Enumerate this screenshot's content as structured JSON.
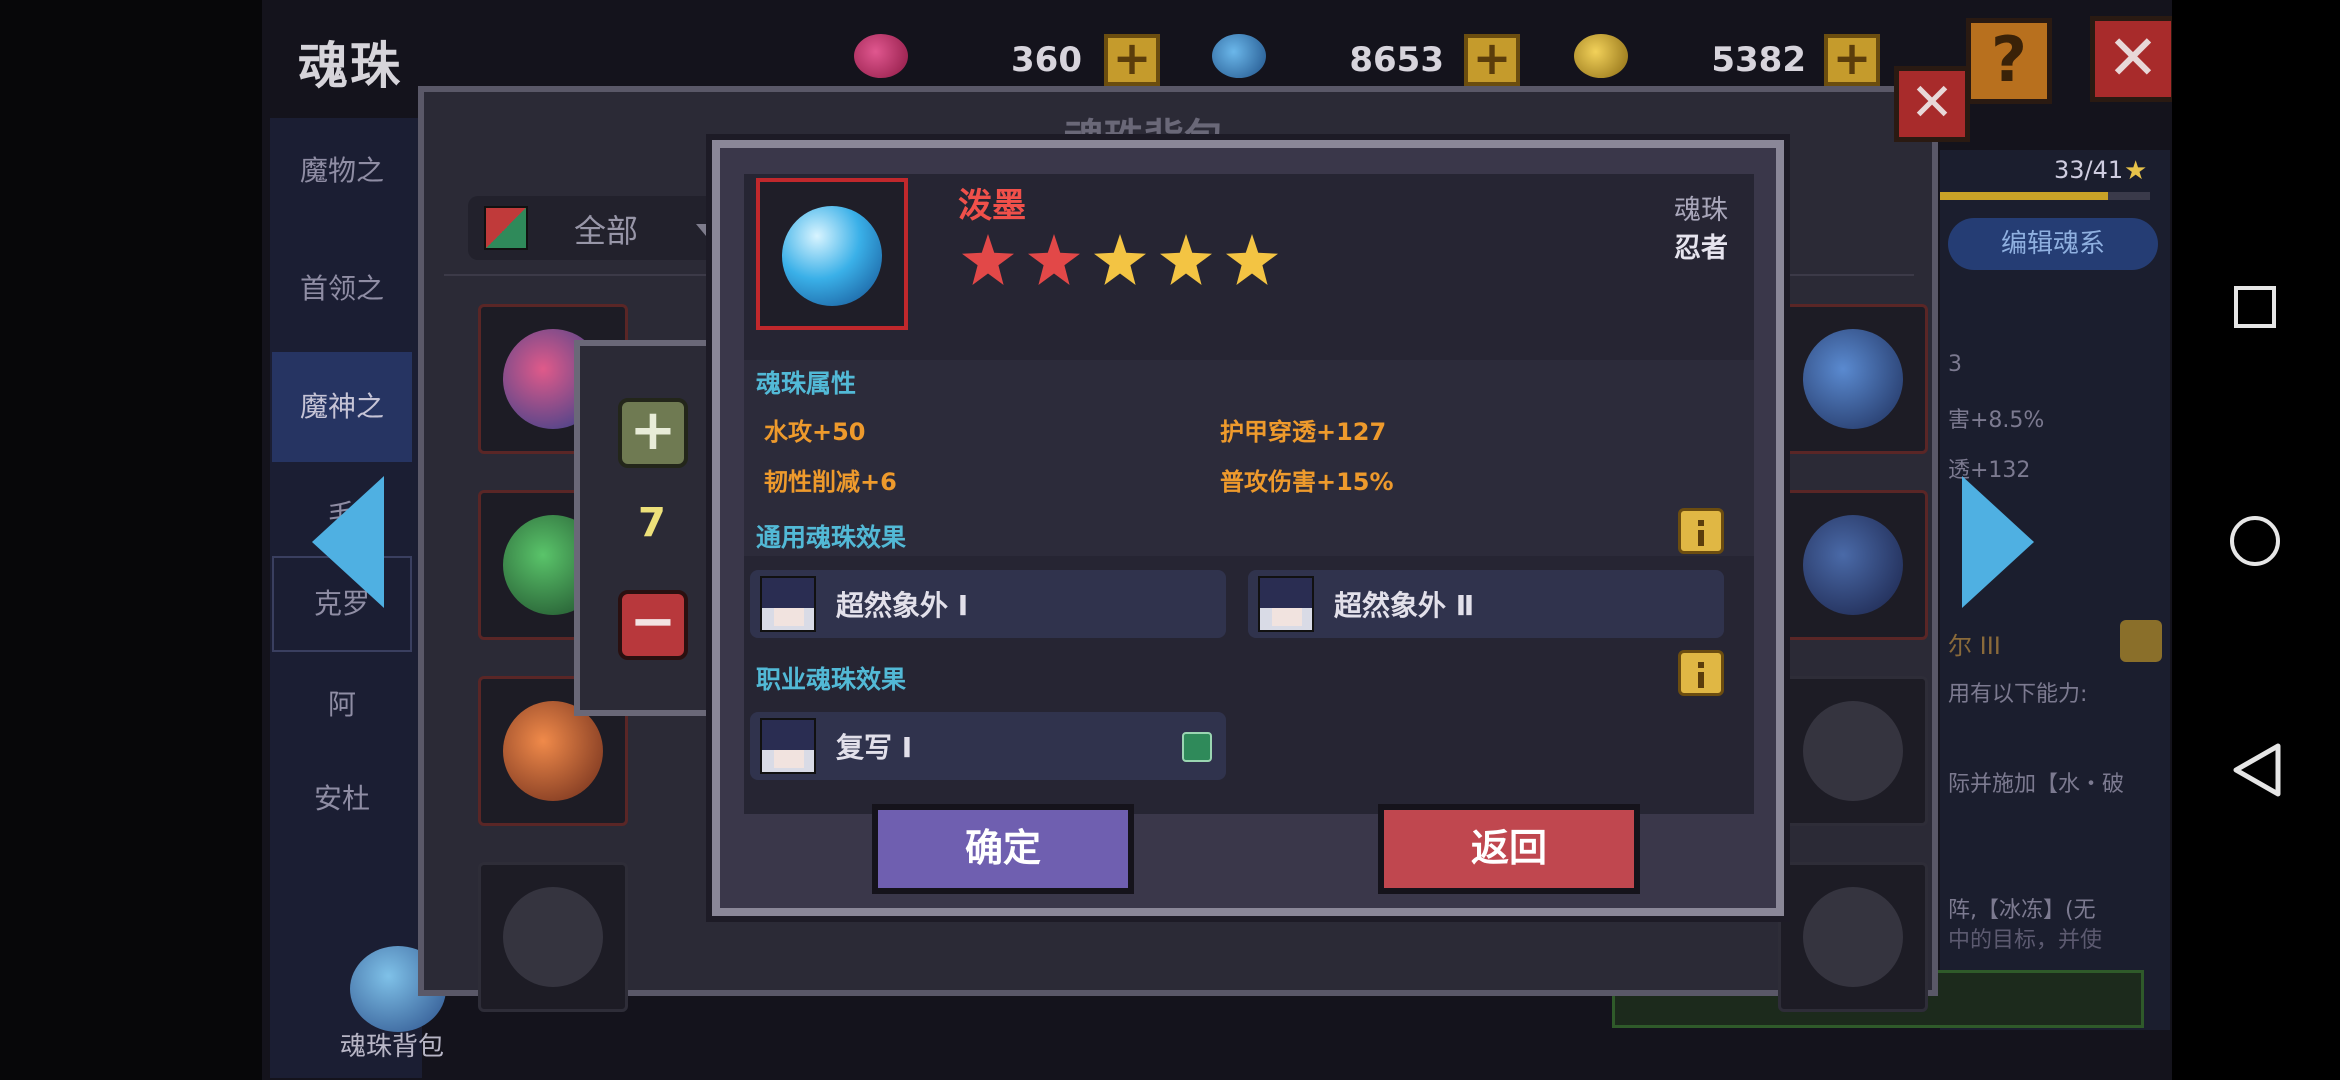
{
  "screen_title": "魂珠",
  "currencies": [
    {
      "icon": "purple-gem-icon",
      "value": "360",
      "color": "#b0245e"
    },
    {
      "icon": "blue-gem-icon",
      "value": "8653",
      "color": "#2f78b8"
    },
    {
      "icon": "gold-coin-icon",
      "value": "5382",
      "color": "#c9a227"
    }
  ],
  "side_tabs": [
    {
      "label": "魔物之"
    },
    {
      "label": "首领之"
    },
    {
      "label": "魔神之"
    },
    {
      "label": "毛"
    },
    {
      "label": "克罗"
    },
    {
      "label": "阿"
    },
    {
      "label": "安杜"
    }
  ],
  "bag": {
    "title": "魂珠背包",
    "filter_label": "全部",
    "bottom_label": "魂珠背包"
  },
  "quantity": {
    "value": "7"
  },
  "right_panel": {
    "count": "33/41",
    "edit_button": "编辑魂系",
    "lines": [
      "3",
      "害+8.5%",
      "透+132",
      "尔 III",
      "用有以下能力:",
      "际并施加【水・破",
      "阵,【冰冻】(无",
      "中的目标，并使"
    ]
  },
  "detail": {
    "name": "泼墨",
    "type_label": "魂珠",
    "class_label": "忍者",
    "stars": {
      "total": 5,
      "red": 2,
      "gold": 3
    },
    "attr_section": "魂珠属性",
    "attributes": [
      "水攻+50",
      "护甲穿透+127",
      "韧性削减+6",
      "普攻伤害+15%"
    ],
    "common_section": "通用魂珠效果",
    "common_effects": [
      "超然象外 Ⅰ",
      "超然象外 Ⅱ"
    ],
    "class_section": "职业魂珠效果",
    "class_effects": [
      "复写 Ⅰ"
    ],
    "confirm_label": "确定",
    "back_label": "返回"
  },
  "colors": {
    "name_red": "#f0504a",
    "section_blue": "#52b9d6",
    "attr_orange": "#ee9a2c",
    "confirm_purple": "#6f5fb0",
    "back_red": "#c0474f"
  }
}
